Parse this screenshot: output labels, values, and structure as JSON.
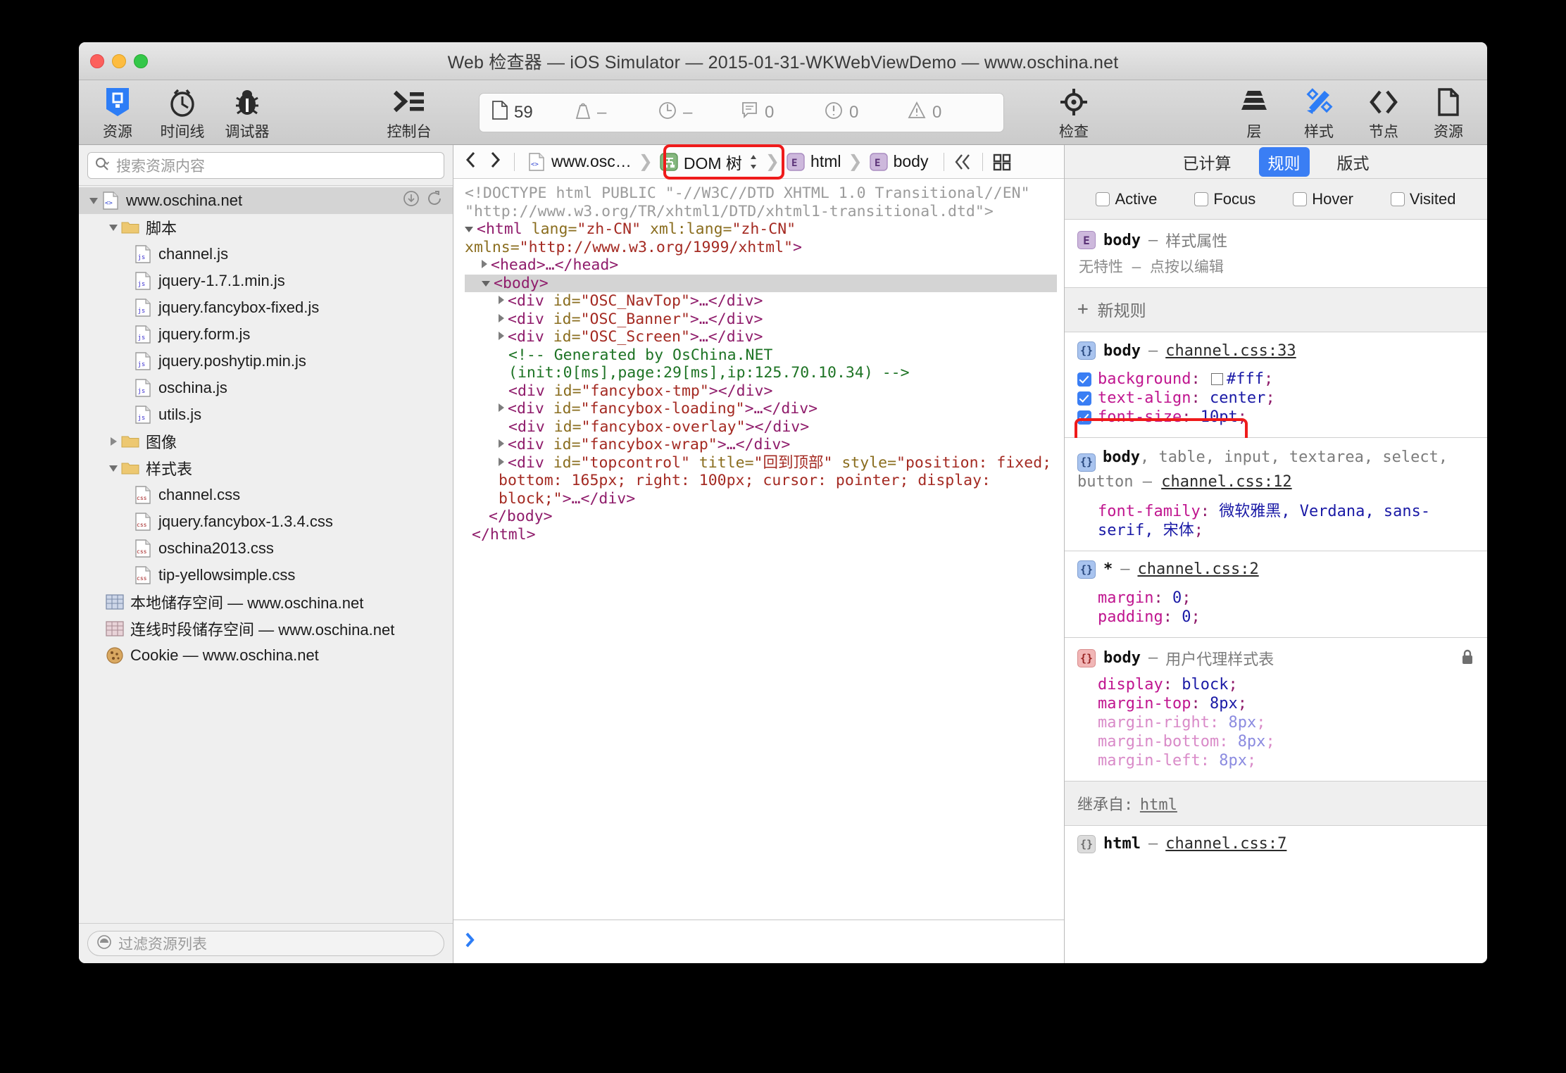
{
  "window": {
    "title": "Web 检查器 — iOS Simulator — 2015-01-31-WKWebViewDemo — www.oschina.net"
  },
  "toolbar": {
    "left_items": [
      {
        "label": "资源",
        "icon": "resources-icon",
        "active": true
      },
      {
        "label": "时间线",
        "icon": "timeline-icon",
        "active": false
      },
      {
        "label": "调试器",
        "icon": "debugger-icon",
        "active": false
      }
    ],
    "console_item": {
      "label": "控制台",
      "icon": "console-icon"
    },
    "status": [
      {
        "icon": "document-icon",
        "value": "59"
      },
      {
        "icon": "weight-icon",
        "value": "–"
      },
      {
        "icon": "clock-icon",
        "value": "–"
      },
      {
        "icon": "message-icon",
        "value": "0"
      },
      {
        "icon": "error-icon",
        "value": "0"
      },
      {
        "icon": "warning-icon",
        "value": "0"
      }
    ],
    "right_items": [
      {
        "label": "检查",
        "icon": "crosshair-icon",
        "active": false
      },
      {
        "label": "层",
        "icon": "layers-icon",
        "active": false
      },
      {
        "label": "样式",
        "icon": "style-brush-icon",
        "active": true
      },
      {
        "label": "节点",
        "icon": "angle-brackets-icon",
        "active": false
      },
      {
        "label": "资源",
        "icon": "page-icon",
        "active": false
      }
    ]
  },
  "sidebar": {
    "search_placeholder": "搜索资源内容",
    "filter_placeholder": "过滤资源列表",
    "tree": [
      {
        "label": "www.oschina.net",
        "indent": 0,
        "icon": "html-doc-icon",
        "twisty": "down",
        "selected": true,
        "actions": [
          "download-icon",
          "reload-icon"
        ]
      },
      {
        "label": "脚本",
        "indent": 1,
        "icon": "folder-icon",
        "twisty": "down"
      },
      {
        "label": "channel.js",
        "indent": 2,
        "icon": "js-file-icon"
      },
      {
        "label": "jquery-1.7.1.min.js",
        "indent": 2,
        "icon": "js-file-icon"
      },
      {
        "label": "jquery.fancybox-fixed.js",
        "indent": 2,
        "icon": "js-file-icon"
      },
      {
        "label": "jquery.form.js",
        "indent": 2,
        "icon": "js-file-icon"
      },
      {
        "label": "jquery.poshytip.min.js",
        "indent": 2,
        "icon": "js-file-icon"
      },
      {
        "label": "oschina.js",
        "indent": 2,
        "icon": "js-file-icon"
      },
      {
        "label": "utils.js",
        "indent": 2,
        "icon": "js-file-icon"
      },
      {
        "label": "图像",
        "indent": 1,
        "icon": "folder-icon",
        "twisty": "right"
      },
      {
        "label": "样式表",
        "indent": 1,
        "icon": "folder-icon",
        "twisty": "down"
      },
      {
        "label": "channel.css",
        "indent": 2,
        "icon": "css-file-icon"
      },
      {
        "label": "jquery.fancybox-1.3.4.css",
        "indent": 2,
        "icon": "css-file-icon"
      },
      {
        "label": "oschina2013.css",
        "indent": 2,
        "icon": "css-file-icon"
      },
      {
        "label": "tip-yellowsimple.css",
        "indent": 2,
        "icon": "css-file-icon"
      },
      {
        "label": "本地储存空间 — www.oschina.net",
        "indent": 1,
        "icon": "storage-blue-icon"
      },
      {
        "label": "连线时段储存空间 — www.oschina.net",
        "indent": 1,
        "icon": "storage-pink-icon"
      },
      {
        "label": "Cookie — www.oschina.net",
        "indent": 1,
        "icon": "cookie-icon"
      }
    ]
  },
  "breadcrumb": {
    "back_icon": "chevron-left-icon",
    "forward_icon": "chevron-right-icon",
    "items": [
      {
        "label": "www.osc…",
        "icon": "html-doc-icon"
      },
      {
        "label": "DOM 树",
        "icon": "dom-tree-icon",
        "stepper": true,
        "highlighted": true
      },
      {
        "label": "html",
        "icon": "element-icon"
      },
      {
        "label": "body",
        "icon": "element-icon"
      }
    ],
    "right_icons": [
      "double-chevron-icon",
      "grid-layout-icon"
    ]
  },
  "dom_tree": {
    "lines": [
      {
        "type": "doctype",
        "text": "<!DOCTYPE html PUBLIC \"-//W3C//DTD XHTML 1.0 Transitional//EN\" \"http://www.w3.org/TR/xhtml1/DTD/xhtml1-transitional.dtd\">"
      },
      {
        "type": "html_open",
        "tag": "html",
        "attrs": "lang=\"zh-CN\" xml:lang=\"zh-CN\" xmlns=\"http://www.w3.org/1999/xhtml\""
      },
      {
        "type": "collapsed",
        "tag": "head"
      },
      {
        "type": "body_open",
        "tag": "body",
        "selected": true
      },
      {
        "type": "div",
        "id": "OSC_NavTop",
        "collapsed": true
      },
      {
        "type": "div",
        "id": "OSC_Banner",
        "collapsed": true
      },
      {
        "type": "div",
        "id": "OSC_Screen",
        "collapsed": true
      },
      {
        "type": "comment",
        "text": "<!-- Generated by OsChina.NET (init:0[ms],page:29[ms],ip:125.70.10.34) -->"
      },
      {
        "type": "div_empty",
        "id": "fancybox-tmp"
      },
      {
        "type": "div",
        "id": "fancybox-loading",
        "collapsed": true
      },
      {
        "type": "div_empty",
        "id": "fancybox-overlay"
      },
      {
        "type": "div",
        "id": "fancybox-wrap",
        "collapsed": true
      },
      {
        "type": "div_style",
        "id": "topcontrol",
        "title": "回到顶部",
        "style": "position: fixed; bottom: 165px; right: 100px; cursor: pointer; display: block;"
      },
      {
        "type": "close",
        "tag": "body"
      },
      {
        "type": "close",
        "tag": "html"
      }
    ]
  },
  "console": {
    "prompt_icon": "chevron-right-blue-icon"
  },
  "styles_panel": {
    "tabs": [
      {
        "label": "已计算",
        "active": false
      },
      {
        "label": "规则",
        "active": true
      },
      {
        "label": "版式",
        "active": false
      }
    ],
    "pseudo_states": [
      {
        "label": "Active",
        "checked": false
      },
      {
        "label": "Focus",
        "checked": false
      },
      {
        "label": "Hover",
        "checked": false
      },
      {
        "label": "Visited",
        "checked": false
      }
    ],
    "style_attribute": {
      "selector": "body",
      "source": "样式属性",
      "hint": "无特性 — 点按以编辑"
    },
    "new_rule_label": "新规则",
    "rules": [
      {
        "icon": "blue",
        "selector_matched": "body",
        "selector_rest": "",
        "source": "channel.css:33",
        "declarations": [
          {
            "checkbox": true,
            "property": "background",
            "value": "#fff",
            "swatch": true,
            "dim": false
          },
          {
            "checkbox": true,
            "property": "text-align",
            "value": "center",
            "dim": false
          },
          {
            "checkbox": true,
            "property": "font-size",
            "value": "10pt",
            "dim": false,
            "highlighted": true
          }
        ]
      },
      {
        "icon": "blue",
        "selector_matched": "body",
        "selector_rest": ", table, input, textarea, select, button",
        "source": "channel.css:12",
        "declarations": [
          {
            "checkbox": false,
            "property": "font-family",
            "value": "微软雅黑, Verdana, sans-serif, 宋体",
            "dim": false
          }
        ]
      },
      {
        "icon": "blue",
        "selector_matched": "*",
        "selector_rest": "",
        "source": "channel.css:2",
        "declarations": [
          {
            "checkbox": false,
            "property": "margin",
            "value": "0",
            "dim": false
          },
          {
            "checkbox": false,
            "property": "padding",
            "value": "0",
            "dim": false
          }
        ]
      },
      {
        "icon": "red",
        "selector_matched": "body",
        "selector_rest": "",
        "source": "用户代理样式表",
        "source_plain": true,
        "locked": true,
        "declarations": [
          {
            "checkbox": false,
            "property": "display",
            "value": "block",
            "dim": false
          },
          {
            "checkbox": false,
            "property": "margin-top",
            "value": "8px",
            "dim": false
          },
          {
            "checkbox": false,
            "property": "margin-right",
            "value": "8px",
            "dim": true
          },
          {
            "checkbox": false,
            "property": "margin-bottom",
            "value": "8px",
            "dim": true
          },
          {
            "checkbox": false,
            "property": "margin-left",
            "value": "8px",
            "dim": true
          }
        ]
      }
    ],
    "inherit_label": "继承自:",
    "inherit_target": "html",
    "inherited_rule": {
      "icon": "grey",
      "selector_matched": "html",
      "source": "channel.css:7"
    }
  },
  "colors": {
    "accent": "#3a7ef4",
    "highlight": "#ef1b1b",
    "property": "#c0158f",
    "value": "#1a1aa6"
  }
}
